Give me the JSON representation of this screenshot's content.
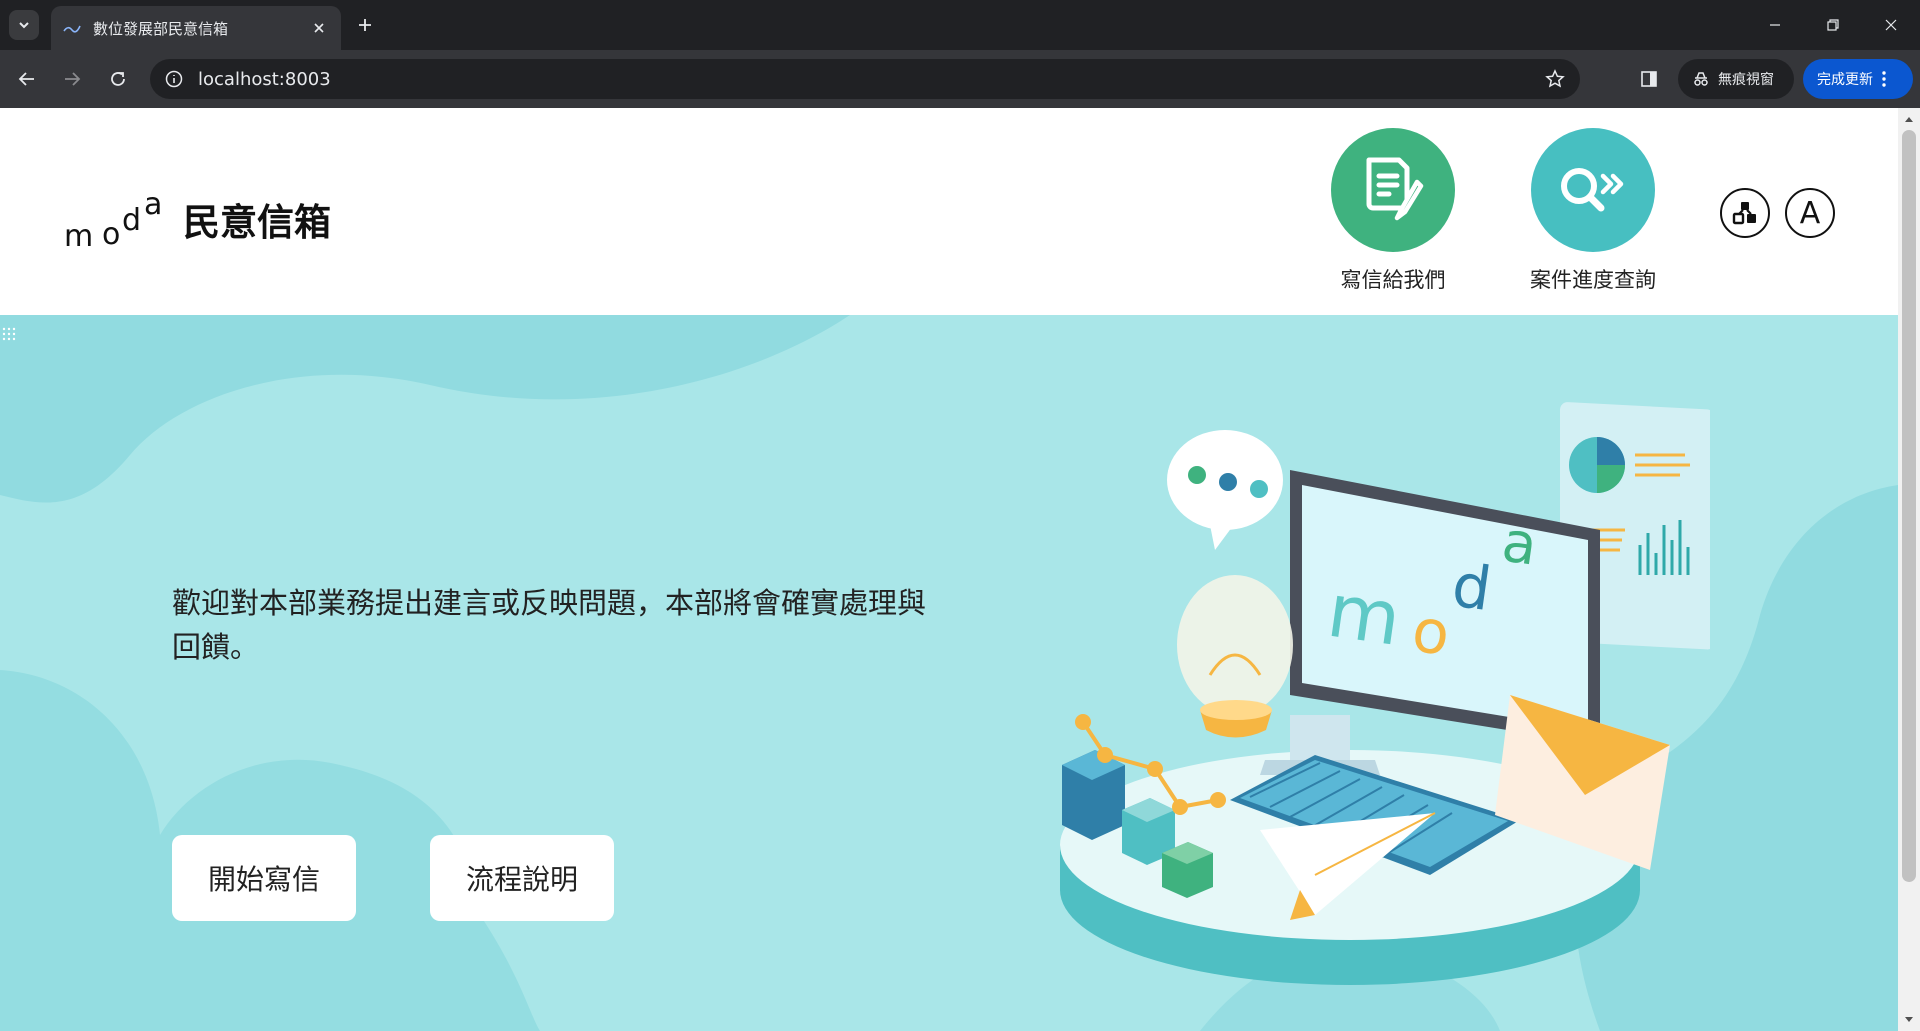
{
  "browser": {
    "tab_title": "數位發展部民意信箱",
    "url": "localhost:8003",
    "incognito_label": "無痕視窗",
    "update_label": "完成更新"
  },
  "header": {
    "logo_text": "moda",
    "site_title": "民意信箱",
    "actions": [
      {
        "label": "寫信給我們",
        "icon": "write-letter-icon",
        "color": "#3fb27f"
      },
      {
        "label": "案件進度查詢",
        "icon": "search-progress-icon",
        "color": "#47bfc1"
      }
    ],
    "font_size_button": "A"
  },
  "hero": {
    "message": "歡迎對本部業務提出建言或反映問題，本部將會確實處理與回饋。",
    "buttons": [
      {
        "label": "開始寫信"
      },
      {
        "label": "流程說明"
      }
    ],
    "background_color": "#a9e6e8",
    "illustration_text": "moda"
  }
}
